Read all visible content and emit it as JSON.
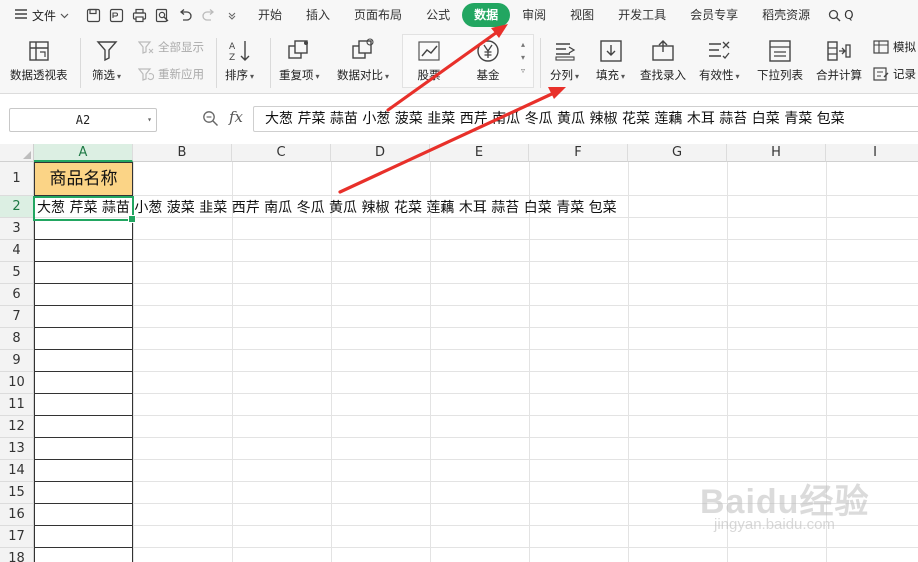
{
  "menubar": {
    "file_label": "文件",
    "tabs": [
      {
        "label": "开始",
        "active": false
      },
      {
        "label": "插入",
        "active": false
      },
      {
        "label": "页面布局",
        "active": false
      },
      {
        "label": "公式",
        "active": false
      },
      {
        "label": "数据",
        "active": true
      },
      {
        "label": "审阅",
        "active": false
      },
      {
        "label": "视图",
        "active": false
      },
      {
        "label": "开发工具",
        "active": false
      },
      {
        "label": "会员专享",
        "active": false
      },
      {
        "label": "稻壳资源",
        "active": false
      }
    ],
    "search_label": "Q"
  },
  "ribbon": {
    "pivot_label": "数据透视表",
    "filter_label": "筛选",
    "show_all_label": "全部显示",
    "reapply_label": "重新应用",
    "sort_label": "排序",
    "duplicates_label": "重复项",
    "compare_label": "数据对比",
    "stock_label": "股票",
    "fund_label": "基金",
    "split_label": "分列",
    "fill_label": "填充",
    "lookup_label": "查找录入",
    "validity_label": "有效性",
    "dropdown_label": "下拉列表",
    "merge_calc_label": "合并计算",
    "simulate_label": "模拟",
    "record_label": "记录"
  },
  "formula_bar": {
    "name_box": "A2",
    "fx_label": "fx",
    "content": "大葱 芹菜 蒜苗 小葱 菠菜 韭菜 西芹 南瓜 冬瓜 黄瓜 辣椒 花菜 莲藕 木耳 蒜苔 白菜 青菜 包菜"
  },
  "sheet": {
    "columns": [
      "A",
      "B",
      "C",
      "D",
      "E",
      "F",
      "G",
      "H",
      "I"
    ],
    "rows": [
      "1",
      "2",
      "3",
      "4",
      "5",
      "6",
      "7",
      "8",
      "9",
      "10",
      "11",
      "12",
      "13",
      "14",
      "15",
      "16",
      "17",
      "18"
    ],
    "a1": "商品名称",
    "a2": "大葱  芹菜  蒜苗  小葱  菠菜  韭菜  西芹  南瓜  冬瓜  黄瓜  辣椒  花菜  莲藕  木耳  蒜苔  白菜  青菜  包菜"
  },
  "colors": {
    "accent": "#22a661",
    "header_fill": "#fbd486",
    "arrow": "#e8302a"
  },
  "watermark": {
    "logo": "Baidu经验",
    "url": "jingyan.baidu.com"
  }
}
